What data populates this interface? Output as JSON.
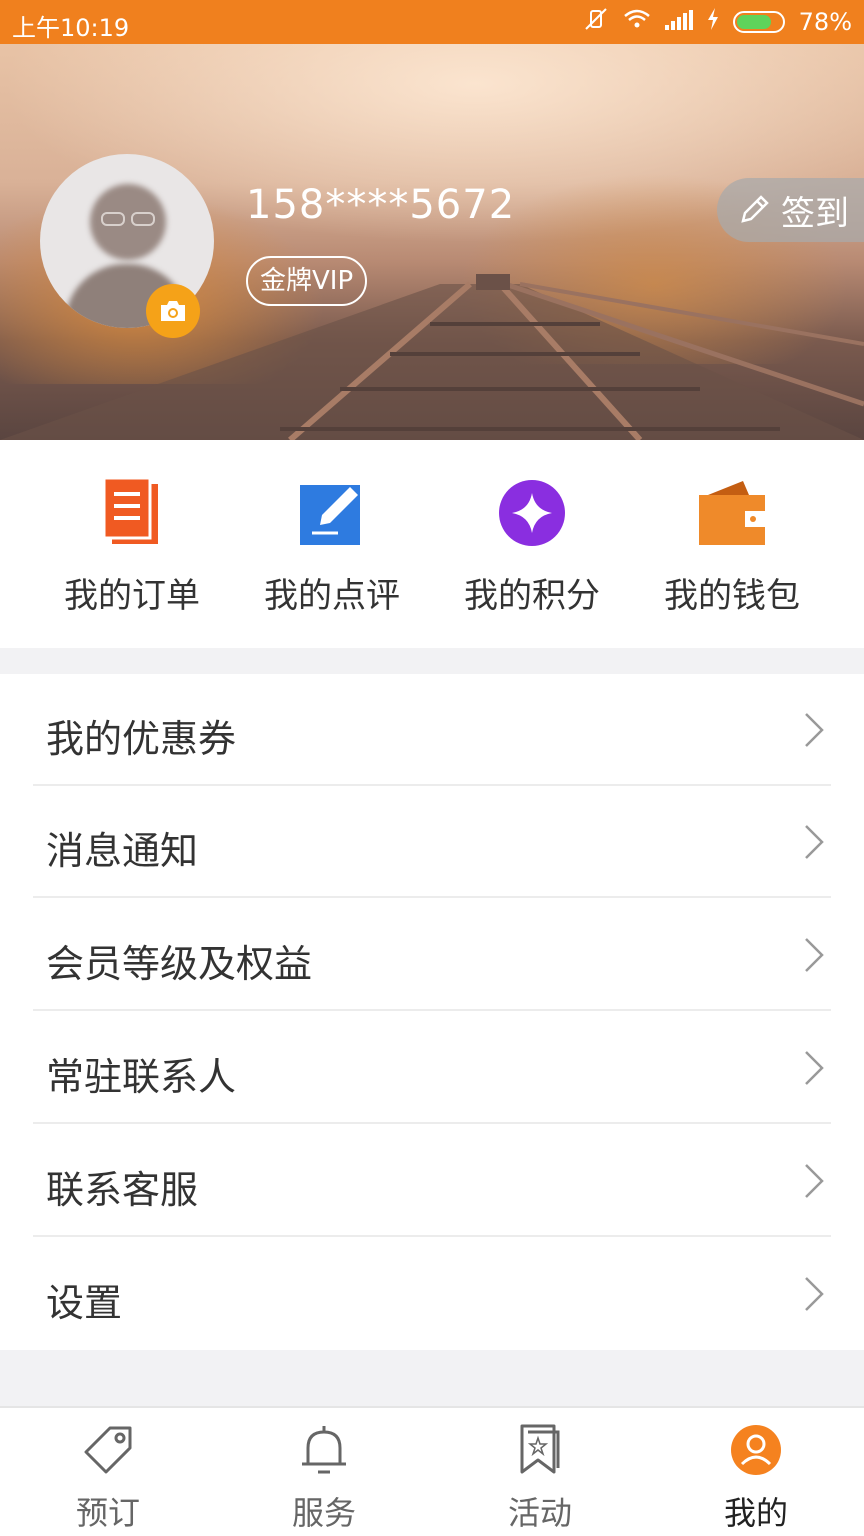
{
  "status_bar": {
    "time": "上午10:19",
    "battery": "78%",
    "battery_level": 0.78
  },
  "profile": {
    "phone": "158****5672",
    "vip_label": "金牌VIP",
    "signin_label": "签到"
  },
  "quick_actions": [
    {
      "label": "我的订单",
      "icon": "orders-icon",
      "color": "#f05a22"
    },
    {
      "label": "我的点评",
      "icon": "edit-review-icon",
      "color": "#2e7be0"
    },
    {
      "label": "我的积分",
      "icon": "star-points-icon",
      "color": "#8a2ee0"
    },
    {
      "label": "我的钱包",
      "icon": "wallet-icon",
      "color": "#ef8a2a"
    }
  ],
  "menu": [
    {
      "label": "我的优惠券"
    },
    {
      "label": "消息通知"
    },
    {
      "label": "会员等级及权益"
    },
    {
      "label": "常驻联系人"
    },
    {
      "label": "联系客服"
    },
    {
      "label": "设置"
    }
  ],
  "bottom_nav": [
    {
      "label": "预订",
      "icon": "tag-icon"
    },
    {
      "label": "服务",
      "icon": "bell-icon"
    },
    {
      "label": "活动",
      "icon": "bookmark-star-icon"
    },
    {
      "label": "我的",
      "icon": "user-icon",
      "active": true
    }
  ],
  "colors": {
    "accent": "#f0801e",
    "active_nav": "#f5821f"
  }
}
